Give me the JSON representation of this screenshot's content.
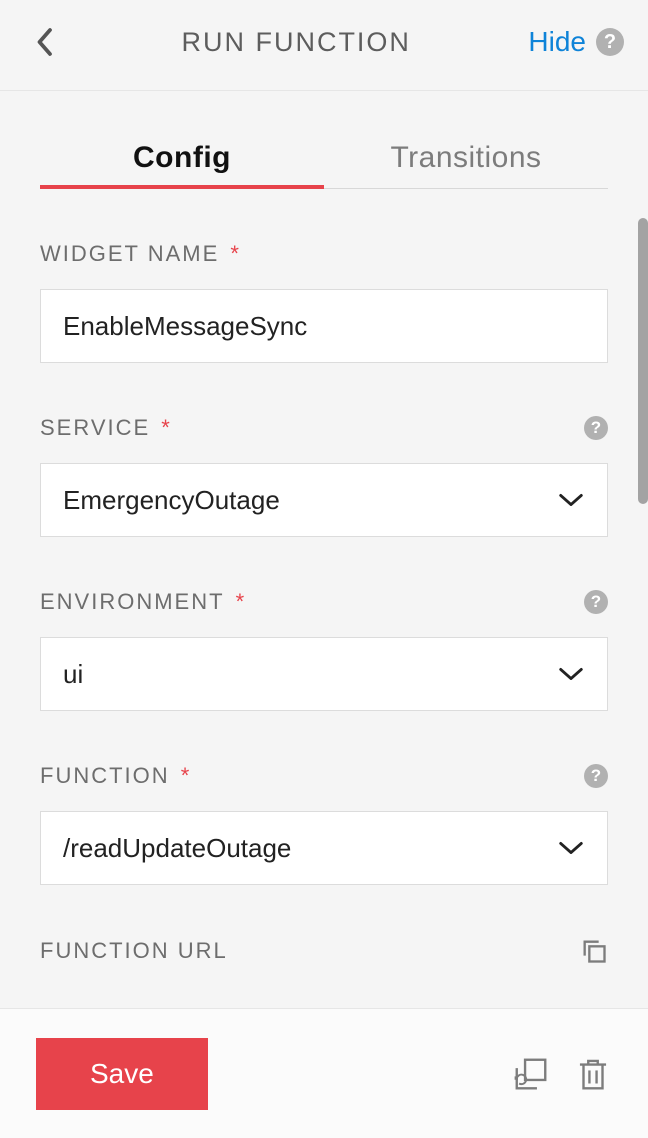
{
  "header": {
    "title": "RUN FUNCTION",
    "hide_label": "Hide"
  },
  "tabs": {
    "config": "Config",
    "transitions": "Transitions"
  },
  "form": {
    "widget_name": {
      "label": "WIDGET NAME",
      "value": "EnableMessageSync"
    },
    "service": {
      "label": "SERVICE",
      "value": "EmergencyOutage"
    },
    "environment": {
      "label": "ENVIRONMENT",
      "value": "ui"
    },
    "function": {
      "label": "FUNCTION",
      "value": "/readUpdateOutage"
    },
    "function_url": {
      "label": "FUNCTION URL"
    }
  },
  "footer": {
    "save_label": "Save"
  }
}
